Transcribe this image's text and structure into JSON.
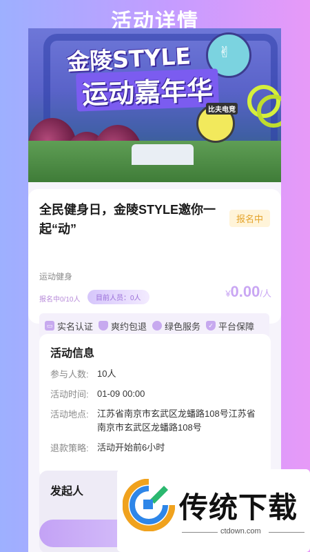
{
  "header": {
    "title": "活动详情"
  },
  "banner": {
    "line1": "金陵STYLE",
    "line2": "运动嘉年华",
    "sticker_label": "比夫电竞"
  },
  "event": {
    "title": "全民健身日，金陵STYLE邀你一起“动”",
    "status": "报名中",
    "category": "运动健身",
    "signup_count": "报名中0/10人",
    "current_people": "目前人员：0人",
    "price_symbol": "¥",
    "price_value": "0.00",
    "price_unit": "/人",
    "guarantees": [
      {
        "label": "实名认证",
        "icon": "id-card-icon"
      },
      {
        "label": "爽约包退",
        "icon": "shield-icon"
      },
      {
        "label": "绿色服务",
        "icon": "leaf-icon"
      },
      {
        "label": "平台保障",
        "icon": "shield-check-icon"
      }
    ]
  },
  "info": {
    "heading": "活动信息",
    "rows": [
      {
        "label": "参与人数:",
        "value": "10人"
      },
      {
        "label": "活动时间:",
        "value": "01-09 00:00"
      },
      {
        "label": "活动地点:",
        "value": "江苏省南京市玄武区龙蟠路108号江苏省南京市玄武区龙蟠路108号"
      },
      {
        "label": "退款策略:",
        "value": "活动开始前6小时"
      }
    ]
  },
  "organizer": {
    "heading": "发起人"
  },
  "watermark": {
    "text": "传统下载",
    "url": "ctdown.com"
  },
  "colors": {
    "accent": "#c9a6f3",
    "status": "#e4a32a",
    "background_start": "#9db0ff",
    "background_end": "#e79af8"
  }
}
